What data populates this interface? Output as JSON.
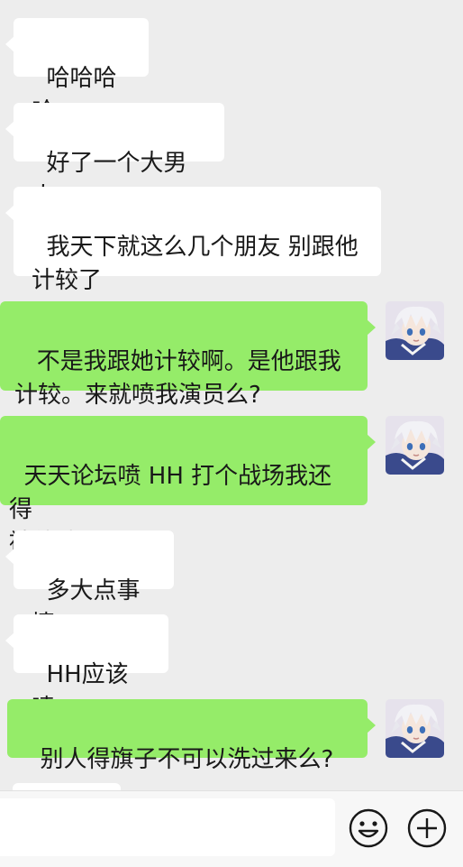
{
  "messages": [
    {
      "side": "in",
      "text": "哈哈哈哈"
    },
    {
      "side": "in",
      "text": "好了一个大男人"
    },
    {
      "side": "in",
      "text": "我天下就这么几个朋友 别跟他\n计较了"
    },
    {
      "side": "out",
      "text": " 不是我跟她计较啊。是他跟我\n计较。来就喷我演员么?"
    },
    {
      "side": "out",
      "text": "天天论坛喷 HH 打个战场我还得\n被他喷?"
    },
    {
      "side": "in",
      "text": "多大点事情"
    },
    {
      "side": "in",
      "text": "HH应该喷"
    },
    {
      "side": "out",
      "text": "别人得旗子不可以洗过来么?"
    }
  ],
  "input": {
    "value": "",
    "placeholder": ""
  },
  "icons": {
    "emoji": "smiley-face-icon",
    "more": "plus-circle-icon",
    "avatar": "user-avatar-anime-white-hair"
  },
  "colors": {
    "background": "#ededed",
    "incoming_bubble": "#ffffff",
    "outgoing_bubble": "#95ec69",
    "text": "#191919"
  }
}
